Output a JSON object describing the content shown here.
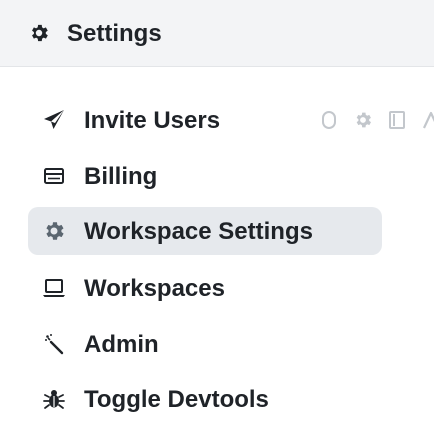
{
  "header": {
    "title": "Settings",
    "icon": "gear-icon"
  },
  "menu": {
    "items": [
      {
        "label": "Invite Users",
        "icon": "paper-plane-icon",
        "active": false
      },
      {
        "label": "Billing",
        "icon": "credit-card-icon",
        "active": false
      },
      {
        "label": "Workspace Settings",
        "icon": "gear-icon",
        "active": true
      },
      {
        "label": "Workspaces",
        "icon": "laptop-icon",
        "active": false
      },
      {
        "label": "Admin",
        "icon": "wand-icon",
        "active": false
      },
      {
        "label": "Toggle Devtools",
        "icon": "bug-icon",
        "active": false
      }
    ]
  },
  "colors": {
    "header_bg": "#f3f4f6",
    "active_bg": "#e6e9ed",
    "text": "#1f2328",
    "icon": "#1f2328",
    "active_icon": "#5b6670",
    "faint_icon": "#b7bcc2"
  }
}
